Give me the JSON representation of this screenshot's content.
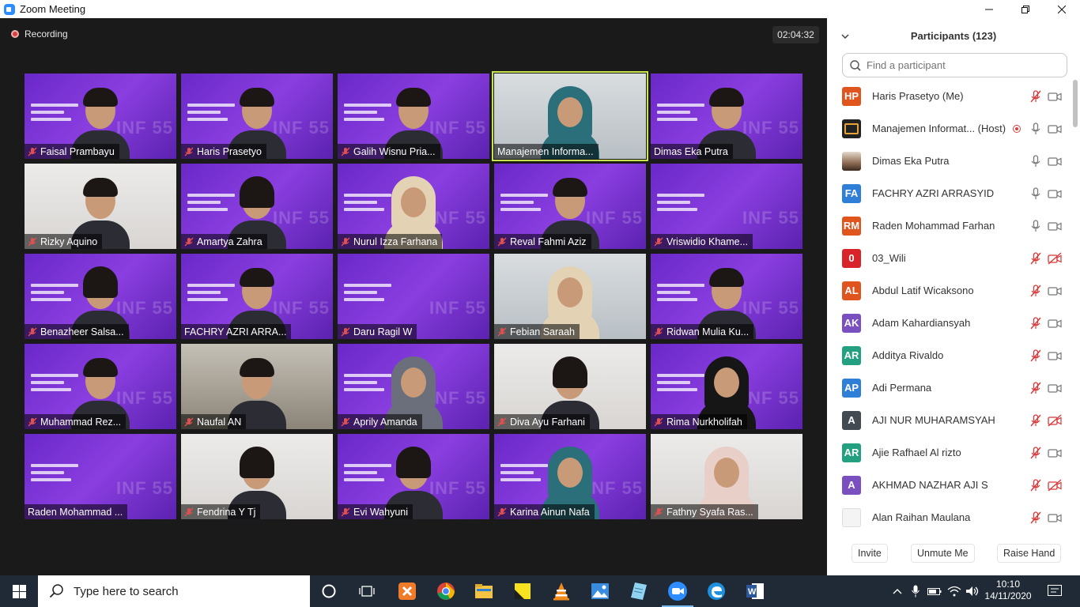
{
  "window": {
    "title": "Zoom Meeting",
    "controls": [
      "minimize",
      "restore",
      "close"
    ]
  },
  "meeting": {
    "recording_label": "Recording",
    "timer": "02:04:32",
    "active_speaker": "Manajemen Informa...",
    "tiles": [
      {
        "name": "Faisal Prambayu",
        "muted": true,
        "bg": "purple",
        "look": "man"
      },
      {
        "name": "Haris Prasetyo",
        "muted": true,
        "bg": "purple",
        "look": "man"
      },
      {
        "name": "Galih Wisnu Pria...",
        "muted": true,
        "bg": "purple",
        "look": "man"
      },
      {
        "name": "Manajemen Informa...",
        "muted": false,
        "bg": "light",
        "look": "hijab-teal"
      },
      {
        "name": "Dimas Eka Putra",
        "muted": false,
        "bg": "purple",
        "look": "man"
      },
      {
        "name": "Rizky Aquino",
        "muted": true,
        "bg": "white",
        "look": "man"
      },
      {
        "name": "Amartya Zahra",
        "muted": true,
        "bg": "purple",
        "look": "woman"
      },
      {
        "name": "Nurul Izza Farhana",
        "muted": true,
        "bg": "purple",
        "look": "hijab-beige"
      },
      {
        "name": "Reval Fahmi Aziz",
        "muted": true,
        "bg": "purple",
        "look": "man"
      },
      {
        "name": "Vriswidio Khame...",
        "muted": true,
        "bg": "purple",
        "look": "none"
      },
      {
        "name": "Benazheer Salsa...",
        "muted": true,
        "bg": "purple",
        "look": "woman"
      },
      {
        "name": "FACHRY AZRI ARRA...",
        "muted": false,
        "bg": "purple",
        "look": "man"
      },
      {
        "name": "Daru Ragil W",
        "muted": true,
        "bg": "purple",
        "look": "none"
      },
      {
        "name": "Febian Saraah",
        "muted": true,
        "bg": "light",
        "look": "hijab-beige"
      },
      {
        "name": "Ridwan Mulia Ku...",
        "muted": true,
        "bg": "purple",
        "look": "man"
      },
      {
        "name": "Muhammad Rez...",
        "muted": true,
        "bg": "purple",
        "look": "man"
      },
      {
        "name": "Naufal AN",
        "muted": true,
        "bg": "room",
        "look": "man"
      },
      {
        "name": "Aprily Amanda",
        "muted": true,
        "bg": "purple",
        "look": "hijab-grey"
      },
      {
        "name": "Diva Ayu Farhani",
        "muted": true,
        "bg": "white",
        "look": "woman"
      },
      {
        "name": "Rima Nurkholifah",
        "muted": true,
        "bg": "purple",
        "look": "hijab-black"
      },
      {
        "name": "Raden Mohammad ...",
        "muted": false,
        "bg": "purple",
        "look": "none"
      },
      {
        "name": "Fendrina Y Tj",
        "muted": true,
        "bg": "white",
        "look": "woman"
      },
      {
        "name": "Evi Wahyuni",
        "muted": true,
        "bg": "purple",
        "look": "woman"
      },
      {
        "name": "Karina Ainun Nafa",
        "muted": true,
        "bg": "purple",
        "look": "hijab-teal"
      },
      {
        "name": "Fathny Syafa Ras...",
        "muted": true,
        "bg": "white",
        "look": "hijab-pink"
      }
    ],
    "watermark": "INF 55"
  },
  "participants": {
    "title": "Participants (123)",
    "search_placeholder": "Find a participant",
    "list": [
      {
        "initials": "HP",
        "color": "#e0541e",
        "name": "Haris Prasetyo (Me)",
        "mic": "muted",
        "cam": "on",
        "avatar": "initials"
      },
      {
        "initials": "",
        "color": "#222222",
        "name": "Manajemen Informat... (Host)",
        "mic": "on",
        "cam": "on",
        "avatar": "logo",
        "recording": true
      },
      {
        "initials": "",
        "color": "#8d6a52",
        "name": "Dimas Eka Putra",
        "mic": "on",
        "cam": "on",
        "avatar": "photo"
      },
      {
        "initials": "FA",
        "color": "#2f7fd8",
        "name": "FACHRY AZRI ARRASYID",
        "mic": "on",
        "cam": "on",
        "avatar": "initials"
      },
      {
        "initials": "RM",
        "color": "#e0541e",
        "name": "Raden Mohammad Farhan",
        "mic": "on",
        "cam": "on",
        "avatar": "initials"
      },
      {
        "initials": "0",
        "color": "#d8232a",
        "name": "03_Wili",
        "mic": "muted",
        "cam": "off",
        "avatar": "initials"
      },
      {
        "initials": "AL",
        "color": "#e0541e",
        "name": "Abdul Latif Wicaksono",
        "mic": "muted",
        "cam": "on",
        "avatar": "initials"
      },
      {
        "initials": "AK",
        "color": "#7a4fc0",
        "name": "Adam Kahardiansyah",
        "mic": "muted",
        "cam": "on",
        "avatar": "initials"
      },
      {
        "initials": "AR",
        "color": "#22a080",
        "name": "Additya Rivaldo",
        "mic": "muted",
        "cam": "on",
        "avatar": "initials"
      },
      {
        "initials": "AP",
        "color": "#2f7fd8",
        "name": "Adi Permana",
        "mic": "muted",
        "cam": "on",
        "avatar": "initials"
      },
      {
        "initials": "A",
        "color": "#444a52",
        "name": "AJI NUR MUHARAMSYAH",
        "mic": "muted",
        "cam": "off",
        "avatar": "initials"
      },
      {
        "initials": "AR",
        "color": "#22a080",
        "name": "Ajie Rafhael Al rizto",
        "mic": "muted",
        "cam": "on",
        "avatar": "initials"
      },
      {
        "initials": "A",
        "color": "#7a4fc0",
        "name": "AKHMAD NAZHAR AJI S",
        "mic": "muted",
        "cam": "off",
        "avatar": "initials"
      },
      {
        "initials": "",
        "color": "#f4f4f4",
        "name": "Alan Raihan Maulana",
        "mic": "muted",
        "cam": "on",
        "avatar": "blank"
      }
    ],
    "buttons": {
      "invite": "Invite",
      "unmute": "Unmute Me",
      "raise_hand": "Raise Hand"
    }
  },
  "taskbar": {
    "search_placeholder": "Type here to search",
    "apps": [
      "cortana-icon",
      "task-view-icon",
      "xampp-icon",
      "chrome-icon",
      "file-explorer-icon",
      "sticky-notes-icon",
      "vlc-icon",
      "photos-icon",
      "notepad-icon",
      "zoom-icon",
      "edge-icon",
      "word-icon"
    ],
    "time": "10:10",
    "date": "14/11/2020"
  },
  "colors": {
    "accent": "#2d8cff",
    "muted_red": "#d93838",
    "active_outline": "#c8e34c",
    "taskbar": "#1f2a36"
  }
}
